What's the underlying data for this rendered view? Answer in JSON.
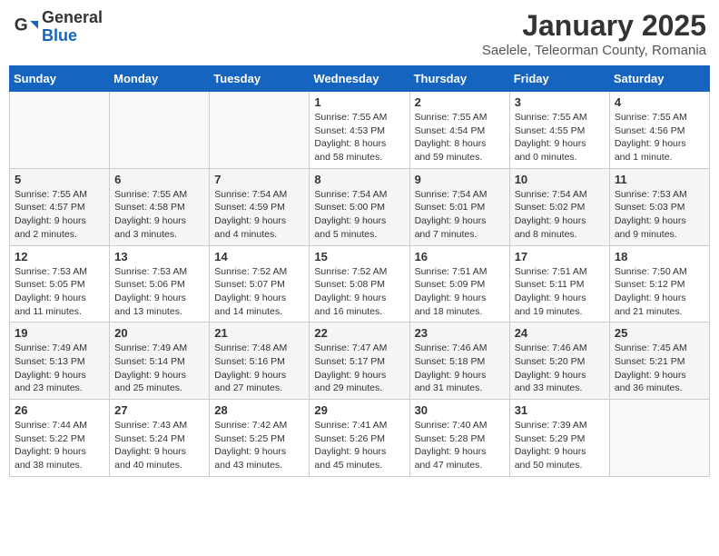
{
  "header": {
    "logo_general": "General",
    "logo_blue": "Blue",
    "month_title": "January 2025",
    "location": "Saelele, Teleorman County, Romania"
  },
  "weekdays": [
    "Sunday",
    "Monday",
    "Tuesday",
    "Wednesday",
    "Thursday",
    "Friday",
    "Saturday"
  ],
  "weeks": [
    [
      {
        "day": "",
        "info": ""
      },
      {
        "day": "",
        "info": ""
      },
      {
        "day": "",
        "info": ""
      },
      {
        "day": "1",
        "info": "Sunrise: 7:55 AM\nSunset: 4:53 PM\nDaylight: 8 hours\nand 58 minutes."
      },
      {
        "day": "2",
        "info": "Sunrise: 7:55 AM\nSunset: 4:54 PM\nDaylight: 8 hours\nand 59 minutes."
      },
      {
        "day": "3",
        "info": "Sunrise: 7:55 AM\nSunset: 4:55 PM\nDaylight: 9 hours\nand 0 minutes."
      },
      {
        "day": "4",
        "info": "Sunrise: 7:55 AM\nSunset: 4:56 PM\nDaylight: 9 hours\nand 1 minute."
      }
    ],
    [
      {
        "day": "5",
        "info": "Sunrise: 7:55 AM\nSunset: 4:57 PM\nDaylight: 9 hours\nand 2 minutes."
      },
      {
        "day": "6",
        "info": "Sunrise: 7:55 AM\nSunset: 4:58 PM\nDaylight: 9 hours\nand 3 minutes."
      },
      {
        "day": "7",
        "info": "Sunrise: 7:54 AM\nSunset: 4:59 PM\nDaylight: 9 hours\nand 4 minutes."
      },
      {
        "day": "8",
        "info": "Sunrise: 7:54 AM\nSunset: 5:00 PM\nDaylight: 9 hours\nand 5 minutes."
      },
      {
        "day": "9",
        "info": "Sunrise: 7:54 AM\nSunset: 5:01 PM\nDaylight: 9 hours\nand 7 minutes."
      },
      {
        "day": "10",
        "info": "Sunrise: 7:54 AM\nSunset: 5:02 PM\nDaylight: 9 hours\nand 8 minutes."
      },
      {
        "day": "11",
        "info": "Sunrise: 7:53 AM\nSunset: 5:03 PM\nDaylight: 9 hours\nand 9 minutes."
      }
    ],
    [
      {
        "day": "12",
        "info": "Sunrise: 7:53 AM\nSunset: 5:05 PM\nDaylight: 9 hours\nand 11 minutes."
      },
      {
        "day": "13",
        "info": "Sunrise: 7:53 AM\nSunset: 5:06 PM\nDaylight: 9 hours\nand 13 minutes."
      },
      {
        "day": "14",
        "info": "Sunrise: 7:52 AM\nSunset: 5:07 PM\nDaylight: 9 hours\nand 14 minutes."
      },
      {
        "day": "15",
        "info": "Sunrise: 7:52 AM\nSunset: 5:08 PM\nDaylight: 9 hours\nand 16 minutes."
      },
      {
        "day": "16",
        "info": "Sunrise: 7:51 AM\nSunset: 5:09 PM\nDaylight: 9 hours\nand 18 minutes."
      },
      {
        "day": "17",
        "info": "Sunrise: 7:51 AM\nSunset: 5:11 PM\nDaylight: 9 hours\nand 19 minutes."
      },
      {
        "day": "18",
        "info": "Sunrise: 7:50 AM\nSunset: 5:12 PM\nDaylight: 9 hours\nand 21 minutes."
      }
    ],
    [
      {
        "day": "19",
        "info": "Sunrise: 7:49 AM\nSunset: 5:13 PM\nDaylight: 9 hours\nand 23 minutes."
      },
      {
        "day": "20",
        "info": "Sunrise: 7:49 AM\nSunset: 5:14 PM\nDaylight: 9 hours\nand 25 minutes."
      },
      {
        "day": "21",
        "info": "Sunrise: 7:48 AM\nSunset: 5:16 PM\nDaylight: 9 hours\nand 27 minutes."
      },
      {
        "day": "22",
        "info": "Sunrise: 7:47 AM\nSunset: 5:17 PM\nDaylight: 9 hours\nand 29 minutes."
      },
      {
        "day": "23",
        "info": "Sunrise: 7:46 AM\nSunset: 5:18 PM\nDaylight: 9 hours\nand 31 minutes."
      },
      {
        "day": "24",
        "info": "Sunrise: 7:46 AM\nSunset: 5:20 PM\nDaylight: 9 hours\nand 33 minutes."
      },
      {
        "day": "25",
        "info": "Sunrise: 7:45 AM\nSunset: 5:21 PM\nDaylight: 9 hours\nand 36 minutes."
      }
    ],
    [
      {
        "day": "26",
        "info": "Sunrise: 7:44 AM\nSunset: 5:22 PM\nDaylight: 9 hours\nand 38 minutes."
      },
      {
        "day": "27",
        "info": "Sunrise: 7:43 AM\nSunset: 5:24 PM\nDaylight: 9 hours\nand 40 minutes."
      },
      {
        "day": "28",
        "info": "Sunrise: 7:42 AM\nSunset: 5:25 PM\nDaylight: 9 hours\nand 43 minutes."
      },
      {
        "day": "29",
        "info": "Sunrise: 7:41 AM\nSunset: 5:26 PM\nDaylight: 9 hours\nand 45 minutes."
      },
      {
        "day": "30",
        "info": "Sunrise: 7:40 AM\nSunset: 5:28 PM\nDaylight: 9 hours\nand 47 minutes."
      },
      {
        "day": "31",
        "info": "Sunrise: 7:39 AM\nSunset: 5:29 PM\nDaylight: 9 hours\nand 50 minutes."
      },
      {
        "day": "",
        "info": ""
      }
    ]
  ]
}
